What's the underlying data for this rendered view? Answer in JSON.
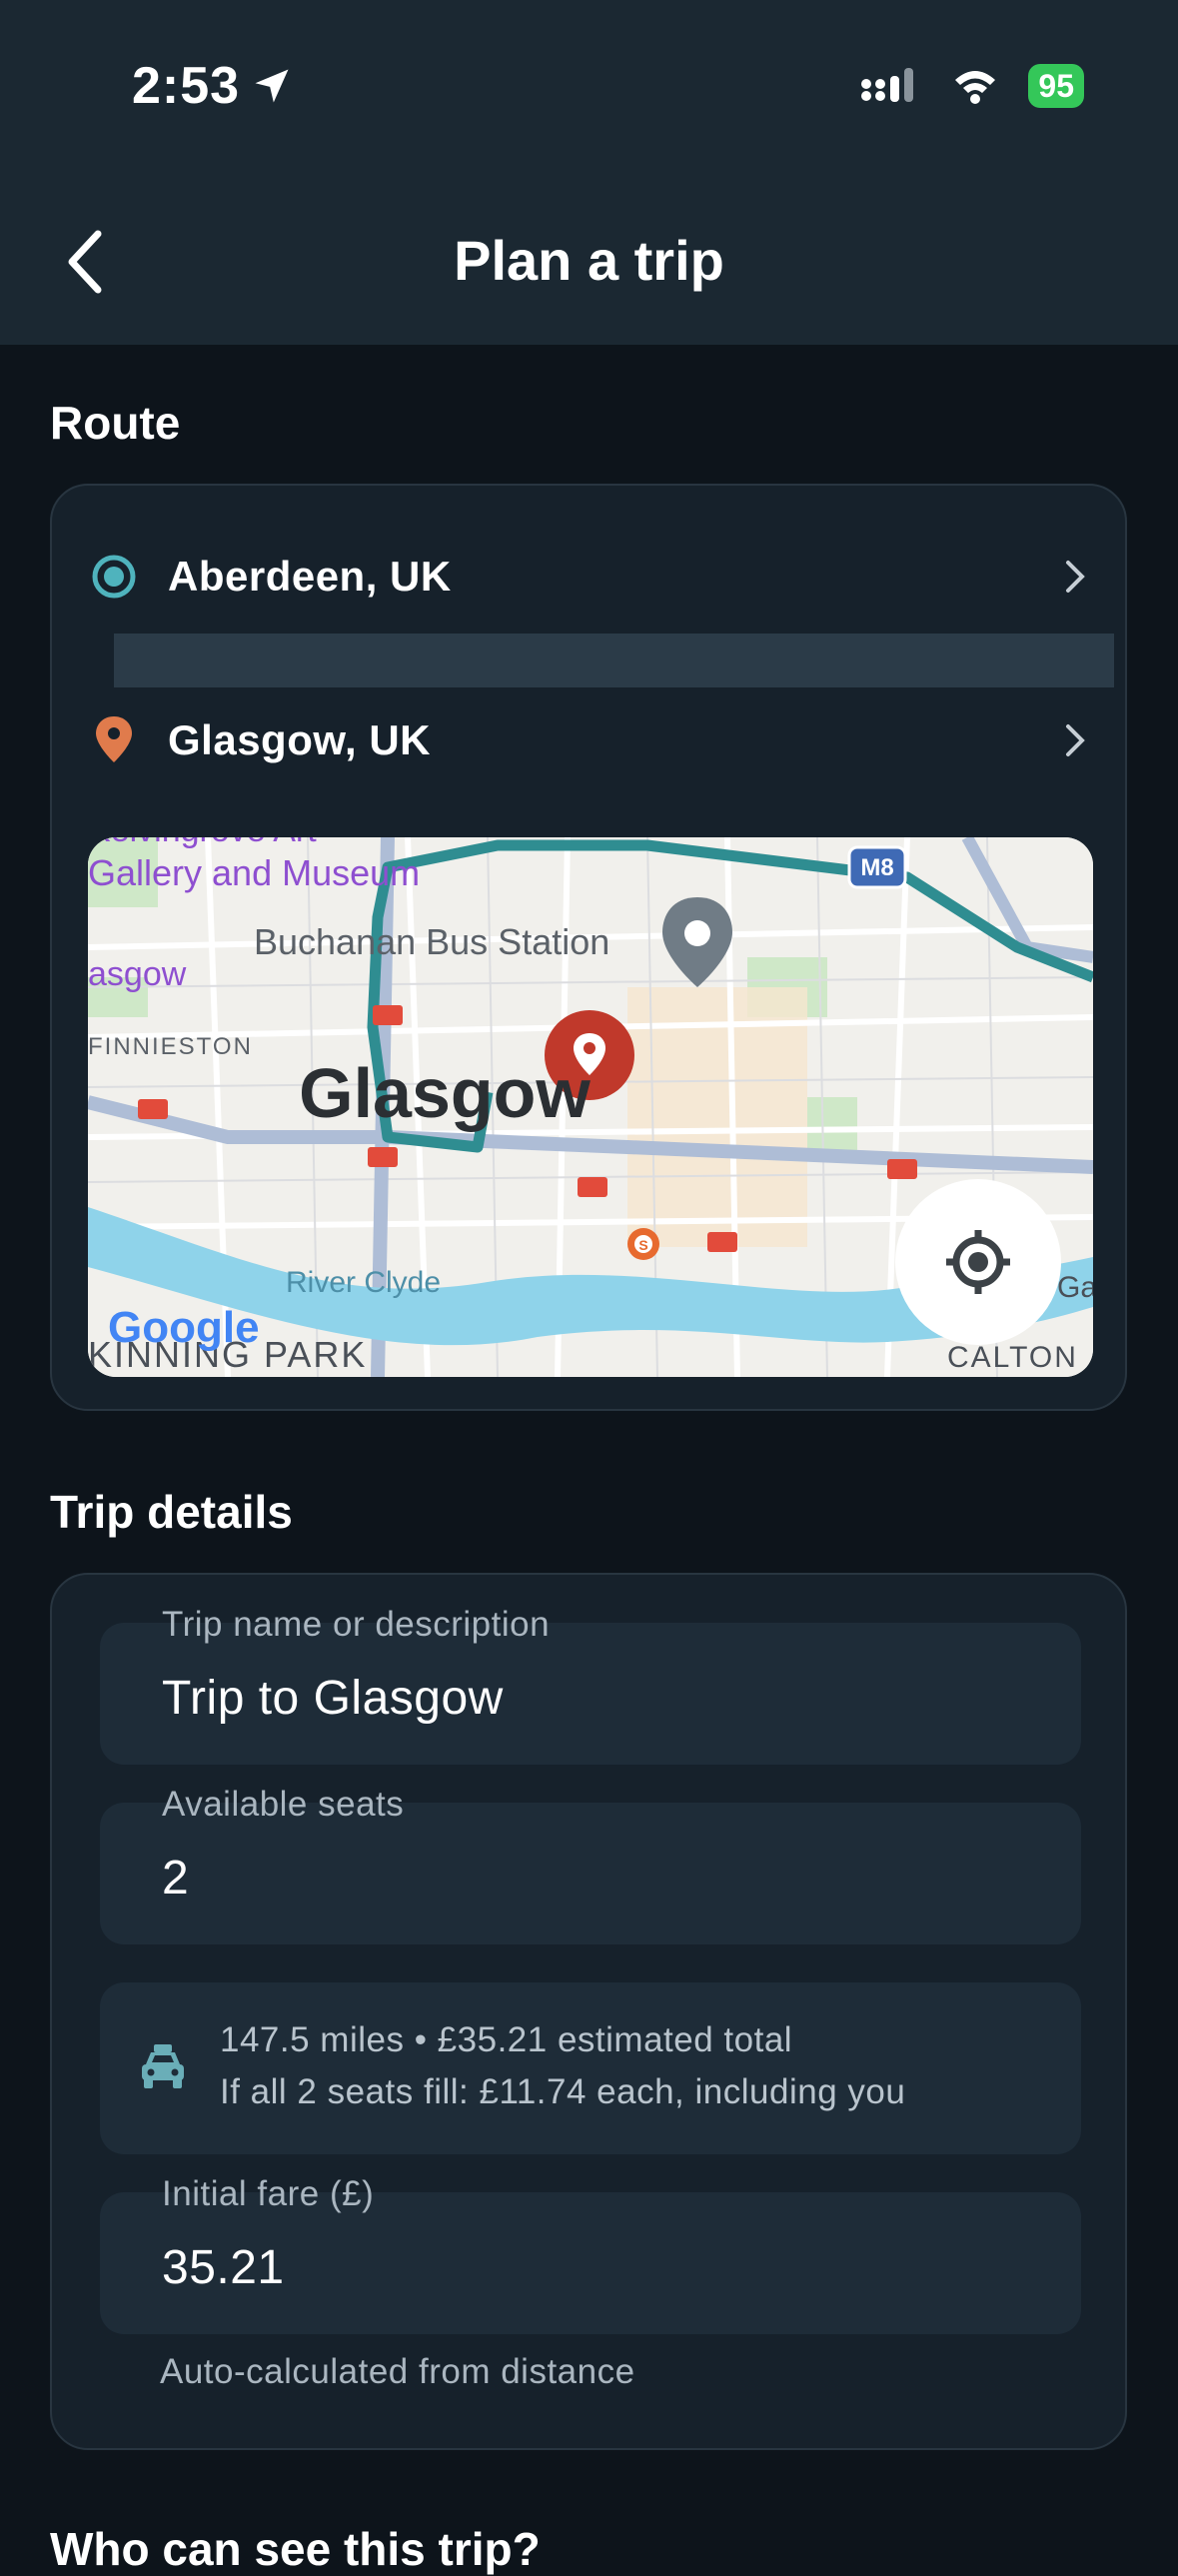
{
  "status_bar": {
    "time": "2:53",
    "battery": "95"
  },
  "header": {
    "title": "Plan a trip"
  },
  "route": {
    "section_title": "Route",
    "origin": "Aberdeen, UK",
    "destination": "Glasgow, UK",
    "map": {
      "labels": {
        "gallery_top": "Kelvingrove Art",
        "gallery": "Gallery and Museum",
        "bus_station": "Buchanan Bus Station",
        "glasgow_left": "asgow",
        "finnieston": "FINNIESTON",
        "city": "Glasgow",
        "river": "River Clyde",
        "kinning_park": "KINNING PARK",
        "calton": "CALTON",
        "ga": "Ga",
        "motorway": "M8",
        "subway": "S",
        "attribution": "Google"
      }
    }
  },
  "trip_details": {
    "section_title": "Trip details",
    "name_label": "Trip name or description",
    "name_value": "Trip to Glasgow",
    "seats_label": "Available seats",
    "seats_value": "2",
    "info_line1": "147.5 miles • £35.21 estimated total",
    "info_line2": "If all 2 seats fill: £11.74 each, including you",
    "fare_label": "Initial fare (£)",
    "fare_value": "35.21",
    "fare_hint": "Auto-calculated from distance"
  },
  "next_section_title": "Who can see this trip?",
  "colors": {
    "accent": "#4fb3bd",
    "pin": "#e07b4c",
    "background": "#0d141b",
    "card": "#16212b"
  }
}
